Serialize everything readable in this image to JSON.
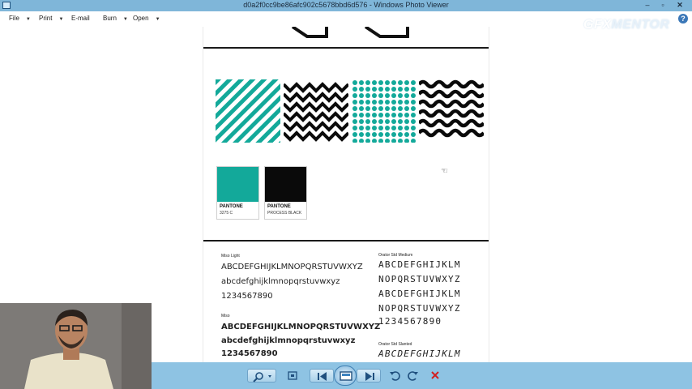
{
  "window": {
    "title": "d0a2f0cc9be86afc902c5678bbd6d576 - Windows Photo Viewer",
    "minimize_glyph": "–",
    "maximize_glyph": "▫",
    "close_glyph": "✕"
  },
  "menubar": {
    "items": [
      {
        "label": "File",
        "has_dropdown": true
      },
      {
        "label": "Print",
        "has_dropdown": true
      },
      {
        "label": "E-mail",
        "has_dropdown": false
      },
      {
        "label": "Burn",
        "has_dropdown": true
      },
      {
        "label": "Open",
        "has_dropdown": true
      }
    ],
    "help_glyph": "?"
  },
  "watermark": {
    "part1": "GFX",
    "part2": "MENTOR"
  },
  "document": {
    "pantone": [
      {
        "brand": "PANTONE",
        "code": "3275 C",
        "color": "#13a99a"
      },
      {
        "brand": "PANTONE",
        "code": "PROCESS BLACK",
        "color": "#0a0a0a"
      }
    ],
    "fonts": {
      "left": {
        "light_label": "Miso Light",
        "light_upper": "ABCDEFGHIJKLMNOPQRSTUVWXYZ",
        "light_lower": "abcdefghijklmnopqrstuvwxyz",
        "light_digits": "1234567890",
        "bold_label": "Miso",
        "bold_upper": "ABCDEFGHIJKLMNOPQRSTUVWXYZ",
        "bold_lower": "abcdefghijklmnopqrstuvwxyz",
        "bold_digits": "1234567890"
      },
      "right": {
        "medium_label": "Orator Std Medium",
        "medium_line1": "ABCDEFGHIJKLM",
        "medium_line2": "NOPQRSTUVWXYZ",
        "medium_line3": "ABCDEFGHIJKLM",
        "medium_line4": "NOPQRSTUVWXYZ",
        "medium_digits": "1234567890",
        "slanted_label": "Orator Std Slanted",
        "slanted_line1": "ABCDEFGHIJKLM"
      }
    }
  },
  "colors": {
    "titlebar": "#7fb6d9",
    "toolbar": "#8ec3e3",
    "teal": "#13a99a",
    "black": "#0a0a0a"
  },
  "toolbar": {
    "icons": [
      "zoom-icon",
      "actual-size-icon",
      "previous-icon",
      "slideshow-icon",
      "next-icon",
      "rotate-counterclockwise-icon",
      "rotate-clockwise-icon",
      "delete-icon"
    ]
  }
}
